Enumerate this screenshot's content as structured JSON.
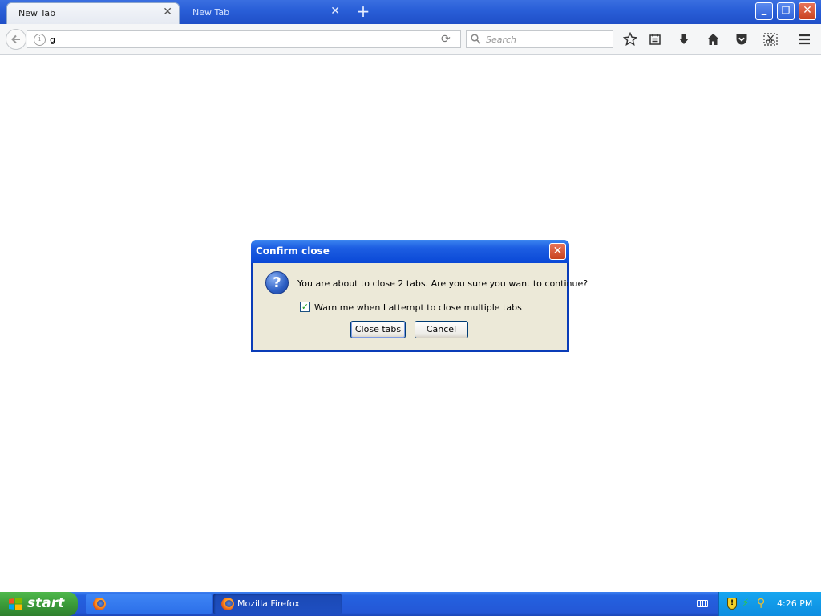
{
  "browser": {
    "tabs": [
      {
        "label": "New Tab",
        "active": true
      },
      {
        "label": "New Tab",
        "active": false
      }
    ],
    "new_tab_symbol": "+",
    "window_controls": {
      "minimize": "_",
      "maximize": "❐",
      "close": "✕"
    },
    "url_value": "g",
    "search_placeholder": "Search",
    "toolbar_icons": [
      "back-arrow-icon",
      "info-icon",
      "reload-icon",
      "search-icon",
      "bookmark-star-icon",
      "reading-list-icon",
      "download-icon",
      "home-icon",
      "pocket-icon",
      "screenshot-icon",
      "hamburger-menu-icon"
    ]
  },
  "dialog": {
    "title": "Confirm close",
    "message": "You are about to close 2 tabs. Are you sure you want to continue?",
    "checkbox_label": "Warn me when I attempt to close multiple tabs",
    "checkbox_checked": true,
    "primary_button": "Close tabs",
    "cancel_button": "Cancel",
    "icon": "question-icon"
  },
  "taskbar": {
    "start_label": "start",
    "window_button_label": "Mozilla Firefox",
    "clock": "4:26 PM"
  },
  "colors": {
    "titlebar_blue": "#2a5fd8",
    "dialog_bg": "#ece9d8",
    "start_green": "#3b9c39",
    "tray_blue": "#0d8de0"
  }
}
